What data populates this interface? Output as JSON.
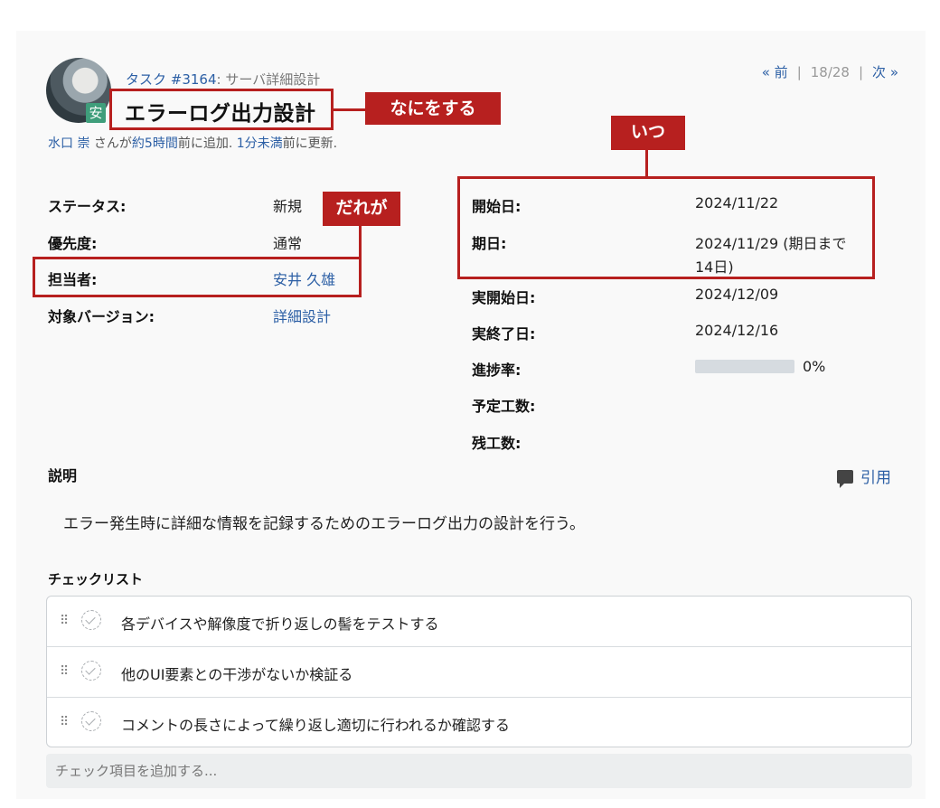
{
  "header": {
    "parent_tracker": "タスク #3164",
    "parent_title": ": サーバ詳細設計",
    "subject": "エラーログ出力設計",
    "assignee_badge": "安",
    "author_name": "水口 崇",
    "author_suffix": " さんが",
    "created_ago": "約5時間",
    "created_suffix": "前に追加. ",
    "updated_ago": "1分未満",
    "updated_suffix": "前に更新."
  },
  "pager": {
    "prev": "« 前",
    "position": "18/28",
    "next": "次 »"
  },
  "attributes": {
    "status_label": "ステータス:",
    "status_value": "新規",
    "priority_label": "優先度:",
    "priority_value": "通常",
    "assignee_label": "担当者:",
    "assignee_value": "安井 久雄",
    "version_label": "対象バージョン:",
    "version_value": "詳細設計",
    "start_label": "開始日:",
    "start_value": "2024/11/22",
    "due_label": "期日:",
    "due_value_line1": "2024/11/29 (期日まで",
    "due_value_line2": "14日)",
    "actual_start_label": "実開始日:",
    "actual_start_value": "2024/12/09",
    "actual_end_label": "実終了日:",
    "actual_end_value": "2024/12/16",
    "progress_label": "進捗率:",
    "progress_percent": 0,
    "progress_text": "0%",
    "estimated_label": "予定工数:",
    "remaining_label": "残工数:"
  },
  "description": {
    "title": "説明",
    "quote_label": "引用",
    "text": "エラー発生時に詳細な情報を記録するためのエラーログ出力の設計を行う。"
  },
  "checklist": {
    "title": "チェックリスト",
    "items": [
      {
        "text": "各デバイスや解像度で折り返しの髻をテストする",
        "done": false
      },
      {
        "text": "他のUI要素との干渉がないか検証る",
        "done": false
      },
      {
        "text": "コメントの長さによって繰り返し適切に行われるか確認する",
        "done": false
      }
    ],
    "add_placeholder": "チェック項目を追加する..."
  },
  "annotations": {
    "what": "なにをする",
    "who": "だれが",
    "when": "いつ",
    "color": "#b7201f"
  }
}
